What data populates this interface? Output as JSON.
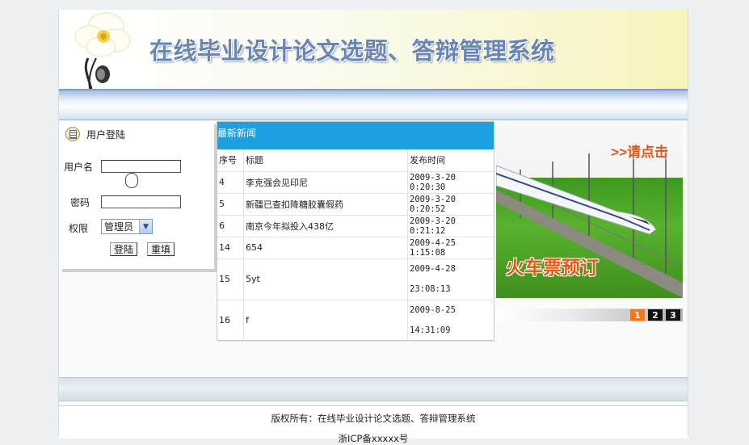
{
  "header": {
    "title": "在线毕业设计论文选题、答辩管理系统"
  },
  "login": {
    "heading": "用户登陆",
    "username_label": "用户名",
    "password_label": "密码",
    "role_label": "权限",
    "role_selected": "管理员",
    "login_button": "登陆",
    "reset_button": "重填"
  },
  "news": {
    "heading": "最新新闻",
    "columns": [
      "序号",
      "标题",
      "发布时间"
    ],
    "rows": [
      {
        "id": "4",
        "title": "李克强会见印尼",
        "date": "2009-3-20 0:20:30"
      },
      {
        "id": "5",
        "title": "新疆已查扣降糖胶囊假药",
        "date": "2009-3-20 0:20:52"
      },
      {
        "id": "6",
        "title": "南京今年拟投入438亿",
        "date": "2009-3-20 0:21:12"
      },
      {
        "id": "14",
        "title": "654",
        "date": "2009-4-25 1:15:08"
      },
      {
        "id": "15",
        "title": "5yt",
        "date": "2009-4-28",
        "date2": "23:08:13"
      },
      {
        "id": "16",
        "title": "f",
        "date": "2009-8-25",
        "date2": "14:31:09"
      }
    ]
  },
  "ad": {
    "click_text": ">>请点击",
    "banner_text": "火车票预订",
    "pages": [
      "1",
      "2",
      "3"
    ],
    "active_page_color": "#f07a1a",
    "page_color": "#111111"
  },
  "footer": {
    "copyright": "版权所有：在线毕业设计论文选题、答辩管理系统",
    "icp": "浙ICP备xxxxx号"
  }
}
